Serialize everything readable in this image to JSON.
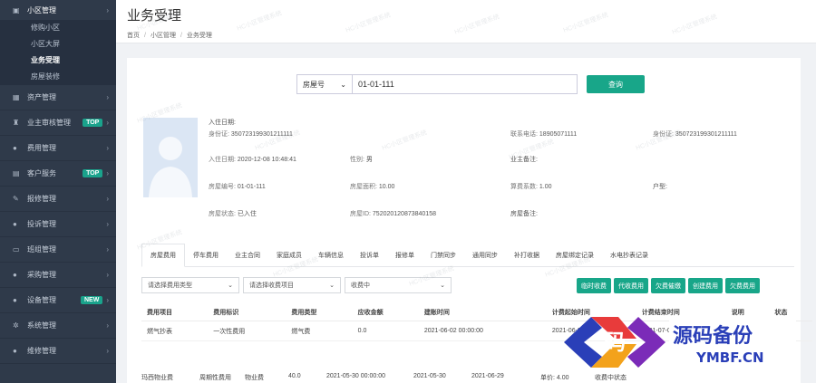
{
  "sidebar": {
    "items": [
      {
        "icon": "▣",
        "label": "小区管理",
        "open": true,
        "sub": [
          {
            "label": "修购小区",
            "active": false
          },
          {
            "label": "小区大屏",
            "active": false
          },
          {
            "label": "业务受理",
            "active": true
          },
          {
            "label": "房屋装修",
            "active": false
          }
        ]
      },
      {
        "icon": "▦",
        "label": "资产管理",
        "badge": ""
      },
      {
        "icon": "♜",
        "label": "业主审核管理",
        "badge": "TOP"
      },
      {
        "icon": "●",
        "label": "费用管理",
        "badge": ""
      },
      {
        "icon": "▤",
        "label": "客户服务",
        "badge": "TOP"
      },
      {
        "icon": "✎",
        "label": "报修管理",
        "badge": ""
      },
      {
        "icon": "●",
        "label": "投诉管理",
        "badge": ""
      },
      {
        "icon": "▭",
        "label": "班组管理",
        "badge": ""
      },
      {
        "icon": "●",
        "label": "采购管理",
        "badge": ""
      },
      {
        "icon": "●",
        "label": "设备管理",
        "badge": "NEW"
      },
      {
        "icon": "✲",
        "label": "系统管理",
        "badge": ""
      },
      {
        "icon": "●",
        "label": "维修管理",
        "badge": ""
      }
    ]
  },
  "header": {
    "title": "业务受理",
    "breadcrumb": [
      "首页",
      "/",
      "小区管理",
      "/",
      "业务受理"
    ]
  },
  "search": {
    "type_label": "房屋号",
    "value": "01-01-111",
    "button": "查询"
  },
  "owner": {
    "checkin_label": "入住日期:",
    "idcard_label": "身份证:",
    "idcard": "350723199301211111",
    "phone_label": "联系电话:",
    "phone": "18905071111",
    "idcard2_label": "身份证:",
    "idcard2": "350723199301211111",
    "checkin_time_label": "入住日期:",
    "checkin_time": "2020-12-08 10:48:41",
    "gender_label": "性别:",
    "gender": "男",
    "remark_label": "业主备注:",
    "room_label": "房屋编号:",
    "room": "01-01-111",
    "area_label": "房屋面积:",
    "area": "10.00",
    "factor_label": "算费系数:",
    "factor": "1.00",
    "type_label": "户型:",
    "status_label": "房屋状态:",
    "status": "已入住",
    "room_id_label": "房屋ID:",
    "room_id": "752020120873840158",
    "room_remark_label": "房屋备注:"
  },
  "tabs": [
    "房屋费用",
    "停车费用",
    "业主合同",
    "家庭成员",
    "车辆信息",
    "投诉单",
    "报修单",
    "门禁同步",
    "通用同步",
    "补打收据",
    "房屋绑定记录",
    "水电抄表记录"
  ],
  "filters": {
    "fee_type_placeholder": "请选择费用类型",
    "fee_item_placeholder": "请选择收费项目",
    "status": "收费中"
  },
  "actions": [
    "临时收费",
    "代收费用",
    "欠费催缴",
    "创建费用",
    "欠费费用"
  ],
  "table": {
    "headers": [
      "费用项目",
      "费用标识",
      "费用类型",
      "应收金额",
      "建账时间",
      "计费起始时间",
      "计费结束时间",
      "说明",
      "状态"
    ],
    "rows": [
      [
        "燃气抄表",
        "一次性费用",
        "燃气费",
        "0.0",
        "2021-06-02 00:00:00",
        "2021-06-02",
        "2021-07-02",
        "",
        ""
      ]
    ]
  },
  "row2": {
    "item": "玛西物业费",
    "flag": "周期性费用",
    "type": "物业费",
    "amount": "40.0",
    "created": "2021-05-30 00:00:00",
    "start": "2021-05-30",
    "end": "2021-06-29",
    "unit_price": "单价: 4.00",
    "status": "收费中状态"
  },
  "watermark": "HC小区管理系统",
  "logo": {
    "mark": "码",
    "name": "源码备份",
    "domain": "YMBF.CN"
  }
}
